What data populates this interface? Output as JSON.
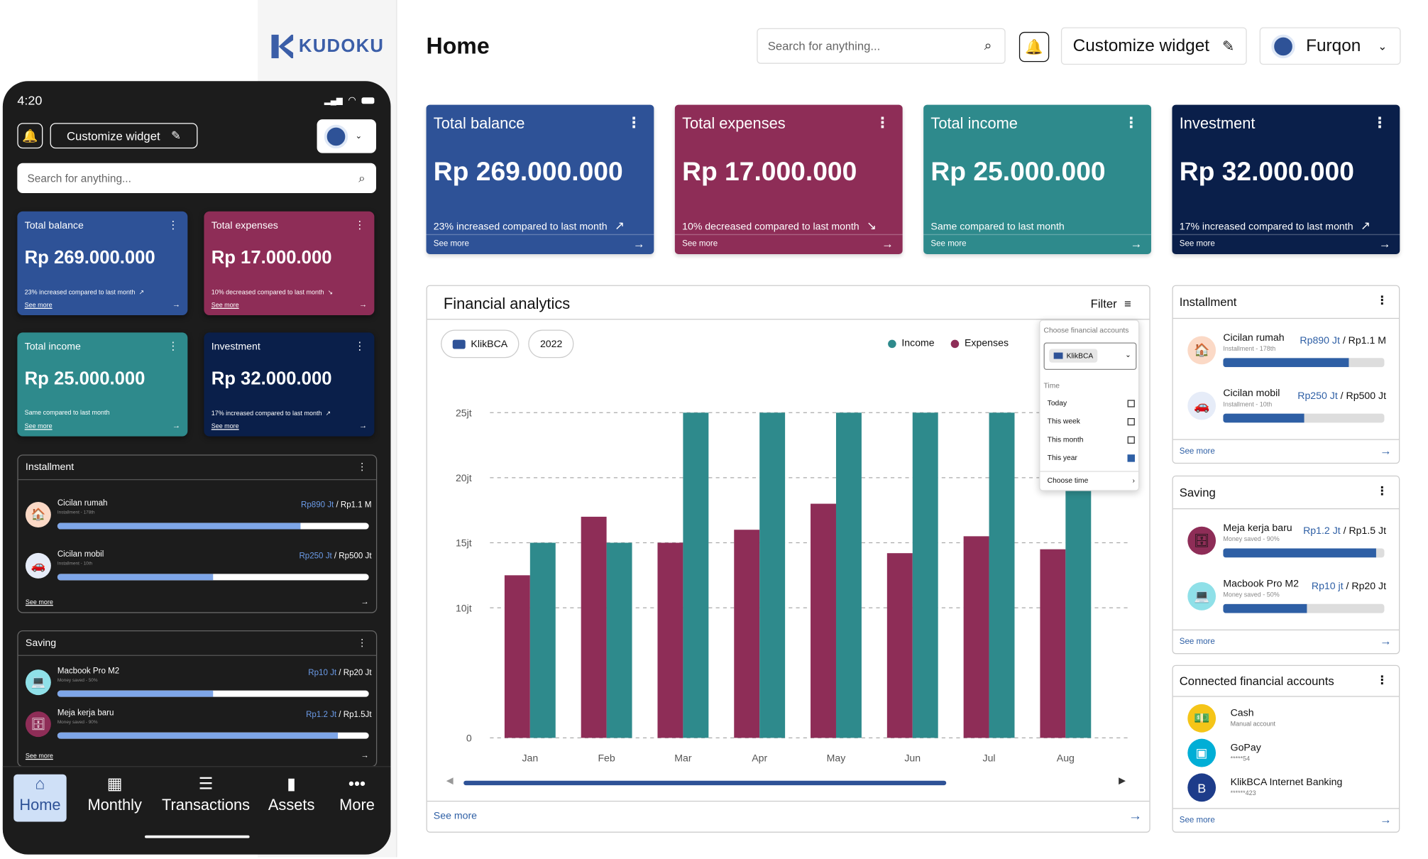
{
  "app": {
    "logo": "KUDOKU"
  },
  "phone": {
    "time": "4:20",
    "customize": "Customize widget",
    "search_placeholder": "Search for anything...",
    "cards": [
      {
        "title": "Total balance",
        "value": "Rp 269.000.000",
        "sub": "23% increased compared to last month",
        "more": "See more",
        "trend": "↗",
        "color": "#2e5297"
      },
      {
        "title": "Total expenses",
        "value": "Rp 17.000.000",
        "sub": "10% decreased compared to last month",
        "more": "See more",
        "trend": "↘",
        "color": "#8e2d57"
      },
      {
        "title": "Total income",
        "value": "Rp 25.000.000",
        "sub": "Same compared to last month",
        "more": "See more",
        "trend": "",
        "color": "#2e8a8c"
      },
      {
        "title": "Investment",
        "value": "Rp 32.000.000",
        "sub": "17% increased compared to last month",
        "more": "See more",
        "trend": "↗",
        "color": "#0a1f4a"
      }
    ],
    "installment": {
      "title": "Installment",
      "items": [
        {
          "name": "Cicilan rumah",
          "sub": "Installment - 178th",
          "paid": "Rp890 Jt",
          "total": " / Rp1.1 M",
          "progress": 0.78
        },
        {
          "name": "Cicilan mobil",
          "sub": "Installment - 10th",
          "paid": "Rp250 Jt",
          "total": " / Rp500 Jt",
          "progress": 0.5
        }
      ],
      "more": "See more"
    },
    "saving": {
      "title": "Saving",
      "items": [
        {
          "name": "Macbook Pro M2",
          "sub": "Money saved - 50%",
          "paid": "Rp10 Jt",
          "total": " / Rp20 Jt",
          "progress": 0.5
        },
        {
          "name": "Meja kerja baru",
          "sub": "Money saved - 90%",
          "paid": "Rp1.2 Jt",
          "total": " / Rp1.5Jt",
          "progress": 0.9
        }
      ],
      "more": "See more"
    },
    "nav": [
      {
        "label": "Home",
        "icon": "home-icon",
        "active": true
      },
      {
        "label": "Monthly",
        "icon": "calendar-icon"
      },
      {
        "label": "Transactions",
        "icon": "list-icon"
      },
      {
        "label": "Assets",
        "icon": "chart-icon"
      },
      {
        "label": "More",
        "icon": "more-icon"
      }
    ]
  },
  "main": {
    "title": "Home",
    "search_placeholder": "Search for anything...",
    "customize": "Customize widget",
    "user": "Furqon",
    "cards": [
      {
        "title": "Total balance",
        "value": "Rp 269.000.000",
        "sub": "23% increased compared to last month",
        "trend": "↗",
        "more": "See more",
        "color": "#2e5297"
      },
      {
        "title": "Total expenses",
        "value": "Rp 17.000.000",
        "sub": "10% decreased compared to last month",
        "trend": "↘",
        "more": "See more",
        "color": "#8e2d57"
      },
      {
        "title": "Total income",
        "value": "Rp 25.000.000",
        "sub": "Same compared to last month",
        "trend": "",
        "more": "See more",
        "color": "#2e8a8c"
      },
      {
        "title": "Investment",
        "value": "Rp 32.000.000",
        "sub": "17% increased compared to last month",
        "trend": "↗",
        "more": "See more",
        "color": "#0a1f4a"
      }
    ],
    "analytics": {
      "title": "Financial analytics",
      "filter": "Filter",
      "chip_account": "KlikBCA",
      "chip_year": "2022",
      "more": "See more",
      "dropdown": {
        "label": "Choose financial accounts",
        "selected": "KlikBCA",
        "time_label": "Time",
        "options": [
          {
            "label": "Today",
            "checked": false
          },
          {
            "label": "This week",
            "checked": false
          },
          {
            "label": "This month",
            "checked": false
          },
          {
            "label": "This year",
            "checked": true
          }
        ],
        "choose_time": "Choose time"
      }
    },
    "installment": {
      "title": "Installment",
      "items": [
        {
          "name": "Cicilan rumah",
          "sub": "Installment - 178th",
          "paid": "Rp890 Jt",
          "total": " / Rp1.1 M",
          "progress": 0.78
        },
        {
          "name": "Cicilan mobil",
          "sub": "Installment - 10th",
          "paid": "Rp250 Jt",
          "total": " / Rp500 Jt",
          "progress": 0.5
        }
      ],
      "more": "See more"
    },
    "saving": {
      "title": "Saving",
      "items": [
        {
          "name": "Meja kerja baru",
          "sub": "Money saved - 90%",
          "paid": "Rp1.2 Jt",
          "total": " / Rp1.5 Jt",
          "progress": 0.95
        },
        {
          "name": "Macbook Pro M2",
          "sub": "Money saved - 50%",
          "paid": "Rp10 jt",
          "total": " / Rp20 Jt",
          "progress": 0.52
        }
      ],
      "more": "See more"
    },
    "connected": {
      "title": "Connected financial accounts",
      "items": [
        {
          "name": "Cash",
          "sub": "Manual account"
        },
        {
          "name": "GoPay",
          "sub": "*****54"
        },
        {
          "name": "KlikBCA Internet Banking",
          "sub": "******423"
        }
      ],
      "more": "See more"
    }
  },
  "chart_data": {
    "type": "bar",
    "categories": [
      "Jan",
      "Feb",
      "Mar",
      "Apr",
      "May",
      "Jun",
      "Jul",
      "Aug"
    ],
    "series": [
      {
        "name": "Income",
        "color": "#2e8a8c",
        "values": [
          15,
          15,
          25,
          25,
          25,
          25,
          25,
          25
        ]
      },
      {
        "name": "Expenses",
        "color": "#8e2d57",
        "values": [
          12.5,
          17,
          15,
          16,
          18,
          14.2,
          15.5,
          14.5
        ]
      }
    ],
    "yticks": [
      "0",
      "10jt",
      "15jt",
      "20jt",
      "25jt"
    ],
    "ylim": [
      0,
      25
    ],
    "grid": true,
    "legend": "top-right"
  }
}
